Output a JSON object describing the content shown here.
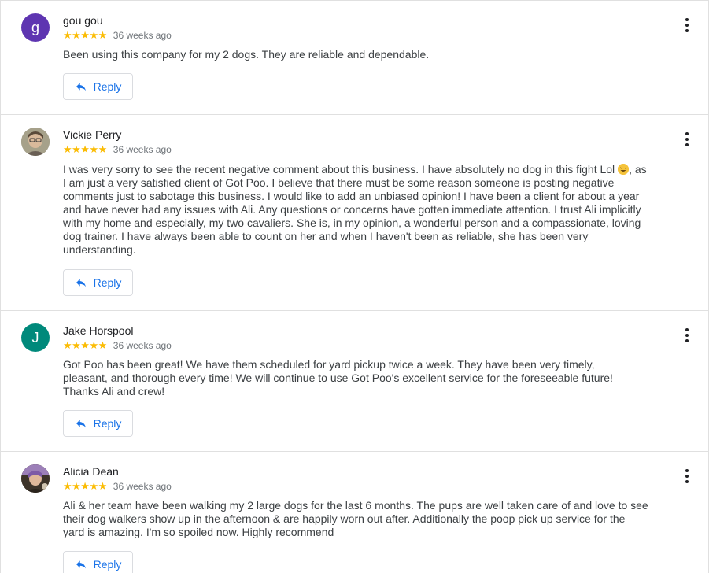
{
  "reviews": [
    {
      "author": "gou gou",
      "initial": "g",
      "avatar_color": "#5e35b1",
      "rating": 5,
      "stars": "★★★★★",
      "time": "36 weeks ago",
      "text": "Been using this company for my 2 dogs. They are reliable and dependable.",
      "reply_label": "Reply"
    },
    {
      "author": "Vickie Perry",
      "initial": "",
      "avatar_color": "#8d8d7a",
      "rating": 5,
      "stars": "★★★★★",
      "time": "36 weeks ago",
      "text_before_emoji": "I was very sorry to see the recent negative comment about this business. I have absolutely no dog in this fight Lol ",
      "text_after_emoji": ", as I am just a very satisfied client of Got Poo. I believe that there must be some reason someone is posting negative comments just to sabotage this business. I would like to add an unbiased opinion! I have been a client for about a year and have never had any issues with Ali. Any questions or concerns have gotten immediate attention. I trust Ali implicitly with my home and especially, my two cavaliers. She is, in my opinion, a wonderful person and a compassionate, loving dog trainer. I have always been able to count on her and when I haven't been as reliable, she has been very understanding.",
      "reply_label": "Reply"
    },
    {
      "author": "Jake Horspool",
      "initial": "J",
      "avatar_color": "#00897b",
      "rating": 5,
      "stars": "★★★★★",
      "time": "36 weeks ago",
      "text": "Got Poo has been great! We have them scheduled for yard pickup twice a week. They have been very timely, pleasant, and thorough every time! We will continue to use Got Poo's excellent service for the foreseeable future! Thanks Ali and crew!",
      "reply_label": "Reply"
    },
    {
      "author": "Alicia Dean",
      "initial": "",
      "avatar_color": "#6b5a4a",
      "rating": 5,
      "stars": "★★★★★",
      "time": "36 weeks ago",
      "text": "Ali & her team have been walking my 2 large dogs for the last 6 months. The pups are well taken care of and love to see their dog walkers show up in the afternoon & are happily worn out after. Additionally the poop pick up service for the yard is amazing. I'm so spoiled now. Highly recommend",
      "reply_label": "Reply"
    }
  ],
  "colors": {
    "star": "#fbbc04",
    "accent": "#1a73e8",
    "divider": "#e0e0e0"
  },
  "icons": {
    "reply": "reply-arrow-icon",
    "more": "more-vert-icon",
    "emoji": "laughing-emoji"
  }
}
